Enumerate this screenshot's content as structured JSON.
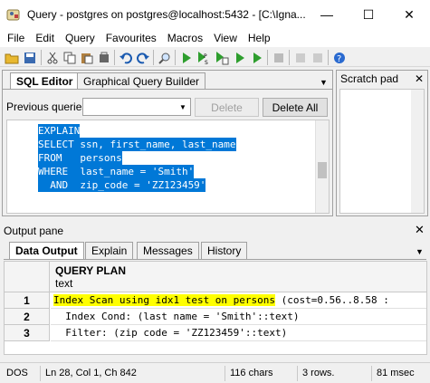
{
  "window": {
    "title": "Query - postgres on postgres@localhost:5432 - [C:\\Igna...",
    "minimize": "—",
    "maximize": "☐",
    "close": "✕"
  },
  "menu": [
    "File",
    "Edit",
    "Query",
    "Favourites",
    "Macros",
    "View",
    "Help"
  ],
  "toolbar": {
    "icons": [
      "open-folder-icon",
      "save-icon",
      "cut-icon",
      "copy-icon",
      "paste-icon",
      "clear-icon",
      "undo-icon",
      "redo-icon",
      "find-icon",
      "execute-icon",
      "execute-pgscript-icon",
      "execute-to-file-icon",
      "explain-icon",
      "explain-analyze-icon",
      "cancel-query-icon",
      "commit-icon",
      "rollback-icon",
      "help-icon"
    ]
  },
  "sql_editor": {
    "tabs": [
      "SQL Editor",
      "Graphical Query Builder"
    ],
    "active_tab": "SQL Editor",
    "previous_queries_label": "Previous queries",
    "previous_queries_value": "",
    "delete_button": "Delete",
    "delete_all_button": "Delete All",
    "code_lines": [
      "EXPLAIN",
      "SELECT ssn, first_name, last_name",
      "FROM   persons",
      "WHERE  last_name = 'Smith'",
      "  AND  zip_code = 'ZZ123459'"
    ]
  },
  "scratch_pad": {
    "title": "Scratch pad",
    "close": "✕"
  },
  "output": {
    "title": "Output pane",
    "close": "✕",
    "tabs": [
      "Data Output",
      "Explain",
      "Messages",
      "History"
    ],
    "active_tab": "Data Output",
    "column": {
      "name": "QUERY PLAN",
      "type": "text"
    },
    "rows": [
      {
        "num": "1",
        "highlight": "Index Scan using idx1 test on persons",
        "rest": " (cost=0.56..8.58 :"
      },
      {
        "num": "2",
        "text": "  Index Cond: (last name = 'Smith'::text)"
      },
      {
        "num": "3",
        "text": "  Filter: (zip code = 'ZZ123459'::text)"
      }
    ]
  },
  "status": {
    "encoding": "DOS",
    "position": "Ln 28, Col 1, Ch 842",
    "chars": "116 chars",
    "rows": "3 rows.",
    "time": "81 msec"
  },
  "colors": {
    "selection": "#0078d7",
    "highlight": "#ffff00",
    "execute_green": "#2e9e2e"
  }
}
